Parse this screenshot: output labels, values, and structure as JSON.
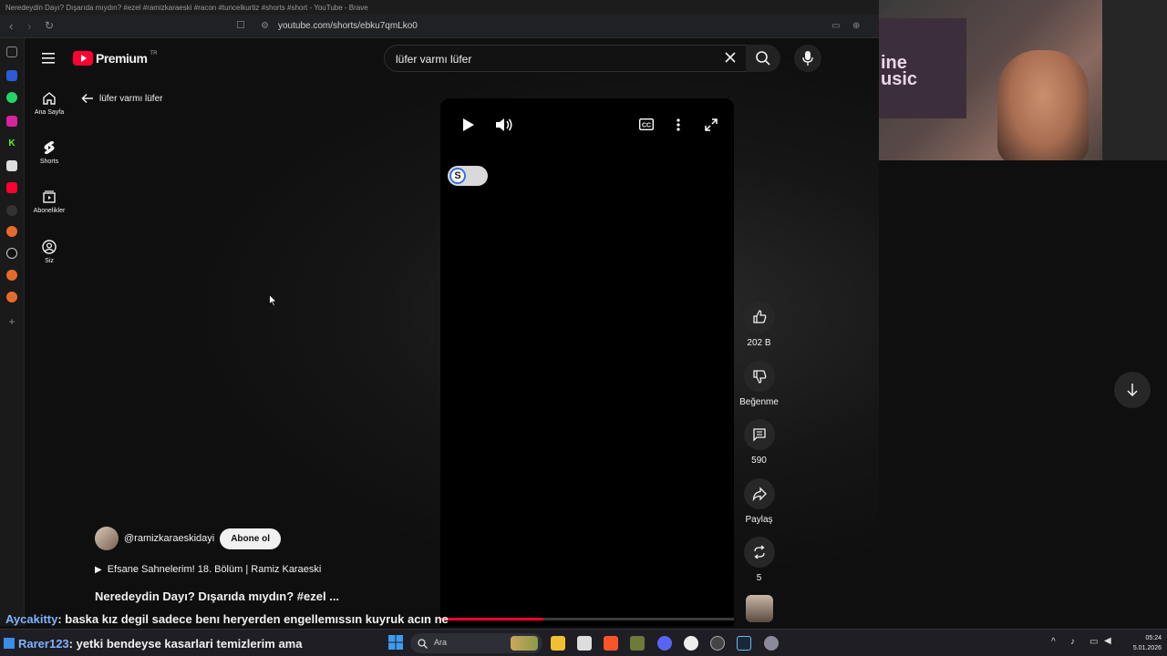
{
  "browser": {
    "title": "Neredeydin Dayı? Dışarıda mıydın? #ezel #ramizkaraeski #racon #tuncelkurtiz #shorts #short - YouTube - Brave",
    "url": "youtube.com/shorts/ebku7qmLko0"
  },
  "header": {
    "logo_text": "Premium",
    "logo_sup": "TR",
    "search_value": "lüfer varmı lüfer"
  },
  "guide": {
    "items": [
      {
        "label": "Ana Sayfa",
        "icon": "home-icon"
      },
      {
        "label": "Shorts",
        "icon": "shorts-icon"
      },
      {
        "label": "Abonelikler",
        "icon": "subscriptions-icon"
      },
      {
        "label": "Siz",
        "icon": "account-icon"
      }
    ]
  },
  "back": {
    "label": "lüfer varmı lüfer"
  },
  "short": {
    "channel": "@ramizkaraeskidayi",
    "subscribe_label": "Abone ol",
    "playlist": "Efsane Sahnelerim! 18. Bölüm | Ramiz Karaeski",
    "title": "Neredeydin Dayı? Dışarıda mıydın? #ezel ...",
    "progress": 0.35
  },
  "actions": {
    "like_count": "202 B",
    "dislike_label": "Beğenme",
    "comment_count": "590",
    "share_label": "Paylaş",
    "remix_count": "5"
  },
  "chat": [
    {
      "user": "Aycakitty",
      "message": ": baska kız degil sadece benı heryerden engellemıssın kuyruk acın ne",
      "color": "#7fb3ff"
    },
    {
      "user": "Rarer123",
      "message": ": yetki bendeyse kasarlari temizlerim ama",
      "color": "#7fb3ff"
    }
  ],
  "taskbar": {
    "search_placeholder": "Ara",
    "time": "05:24",
    "date": "5.01.2026"
  },
  "webcam": {
    "sign_text": "ine\nusic"
  }
}
